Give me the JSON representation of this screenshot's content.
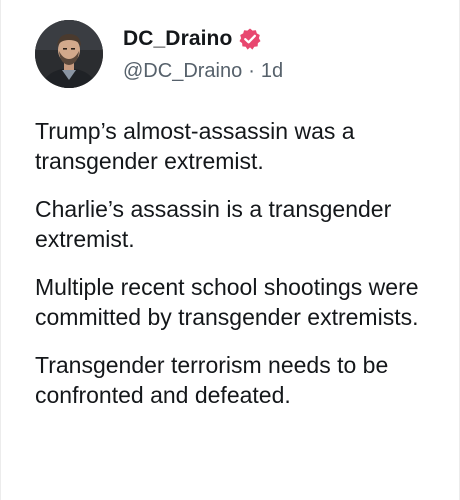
{
  "author": {
    "display_name": "DC_Draino",
    "handle": "@DC_Draino",
    "separator": "·",
    "time_ago": "1d",
    "avatar_icon": "profile-photo",
    "verified_icon": "verified-badge-icon",
    "verified_color": "#e8476f"
  },
  "post": {
    "paragraphs": [
      "Trump’s almost-assassin was a transgender extremist.",
      "Charlie’s assassin is a transgender extremist.",
      "Multiple recent school shootings were committed by transgender extremists.",
      "Transgender terrorism needs to be confronted and defeated."
    ]
  }
}
